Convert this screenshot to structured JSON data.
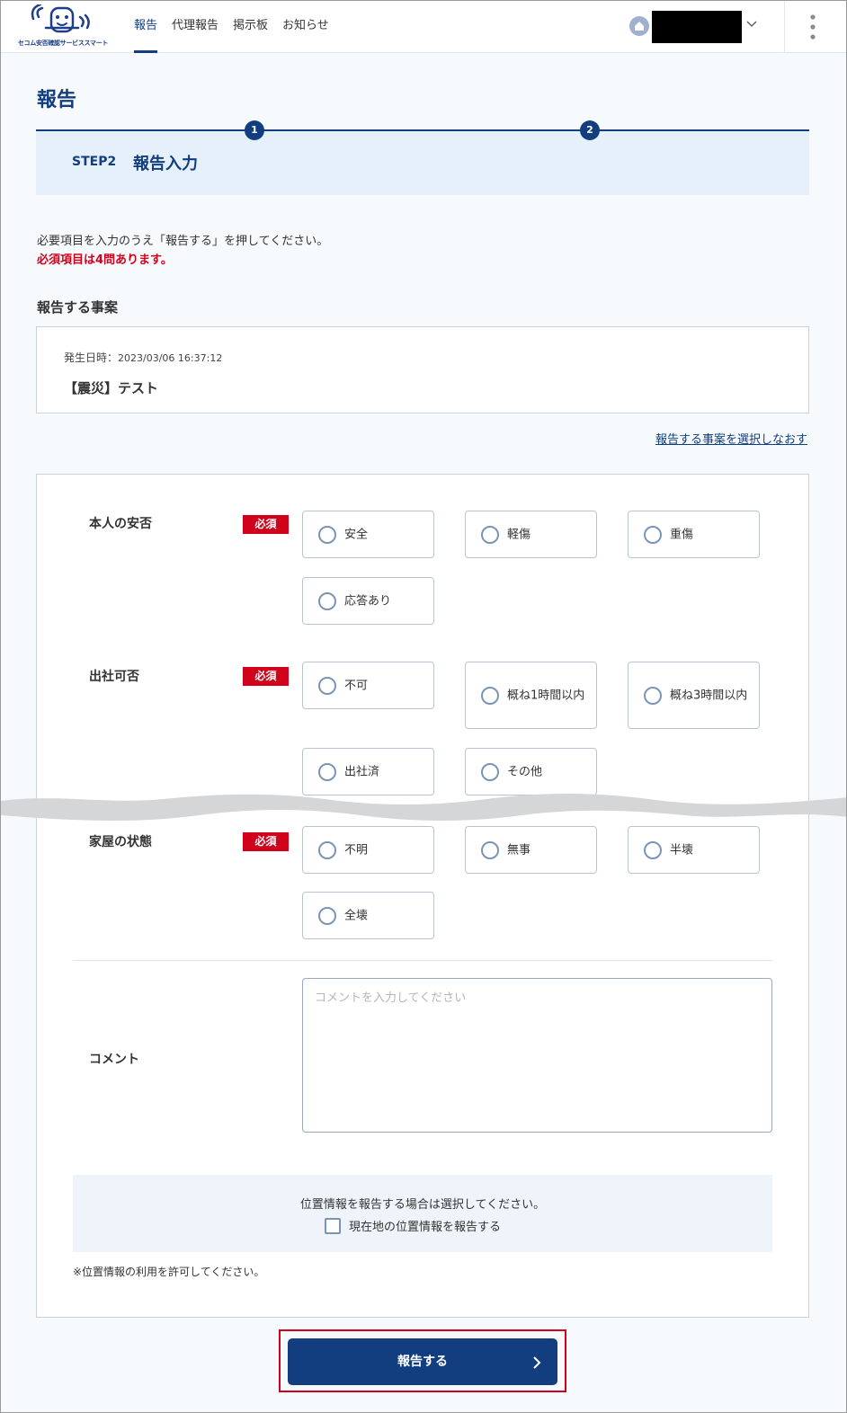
{
  "header": {
    "logo_text": "セコム安否確認サービススマート",
    "nav": [
      "報告",
      "代理報告",
      "掲示板",
      "お知らせ"
    ],
    "active_nav": "報告"
  },
  "page": {
    "title": "報告",
    "steps": [
      "1",
      "2"
    ],
    "step_label": "STEP2",
    "step_title": "報告入力",
    "instruction": "必要項目を入力のうえ「報告する」を押してください。",
    "required_note": "必須項目は4問あります。"
  },
  "incident": {
    "section_title": "報告する事案",
    "date_label": "発生日時：",
    "date_value": "2023/03/06 16:37:12",
    "name": "【震災】テスト",
    "reselect_link": "報告する事案を選択しなおす"
  },
  "questions": [
    {
      "label": "本人の安否",
      "badge": "必須",
      "options": [
        "安全",
        "軽傷",
        "重傷",
        "応答あり"
      ]
    },
    {
      "label": "出社可否",
      "badge": "必須",
      "options": [
        "不可",
        "概ね1時間以内",
        "概ね3時間以内",
        "出社済",
        "その他"
      ]
    },
    {
      "label": "家屋の状態",
      "badge": "必須",
      "options": [
        "不明",
        "無事",
        "半壊",
        "全壊"
      ]
    }
  ],
  "comment": {
    "label": "コメント",
    "placeholder": "コメントを入力してください"
  },
  "location": {
    "prompt": "位置情報を報告する場合は選択してください。",
    "checkbox_label": "現在地の位置情報を報告する",
    "note": "※位置情報の利用を許可してください。"
  },
  "submit": {
    "label": "報告する"
  },
  "colors": {
    "brand": "#123e7f",
    "required": "#d0021b",
    "step_bg": "#e6f0fa"
  }
}
